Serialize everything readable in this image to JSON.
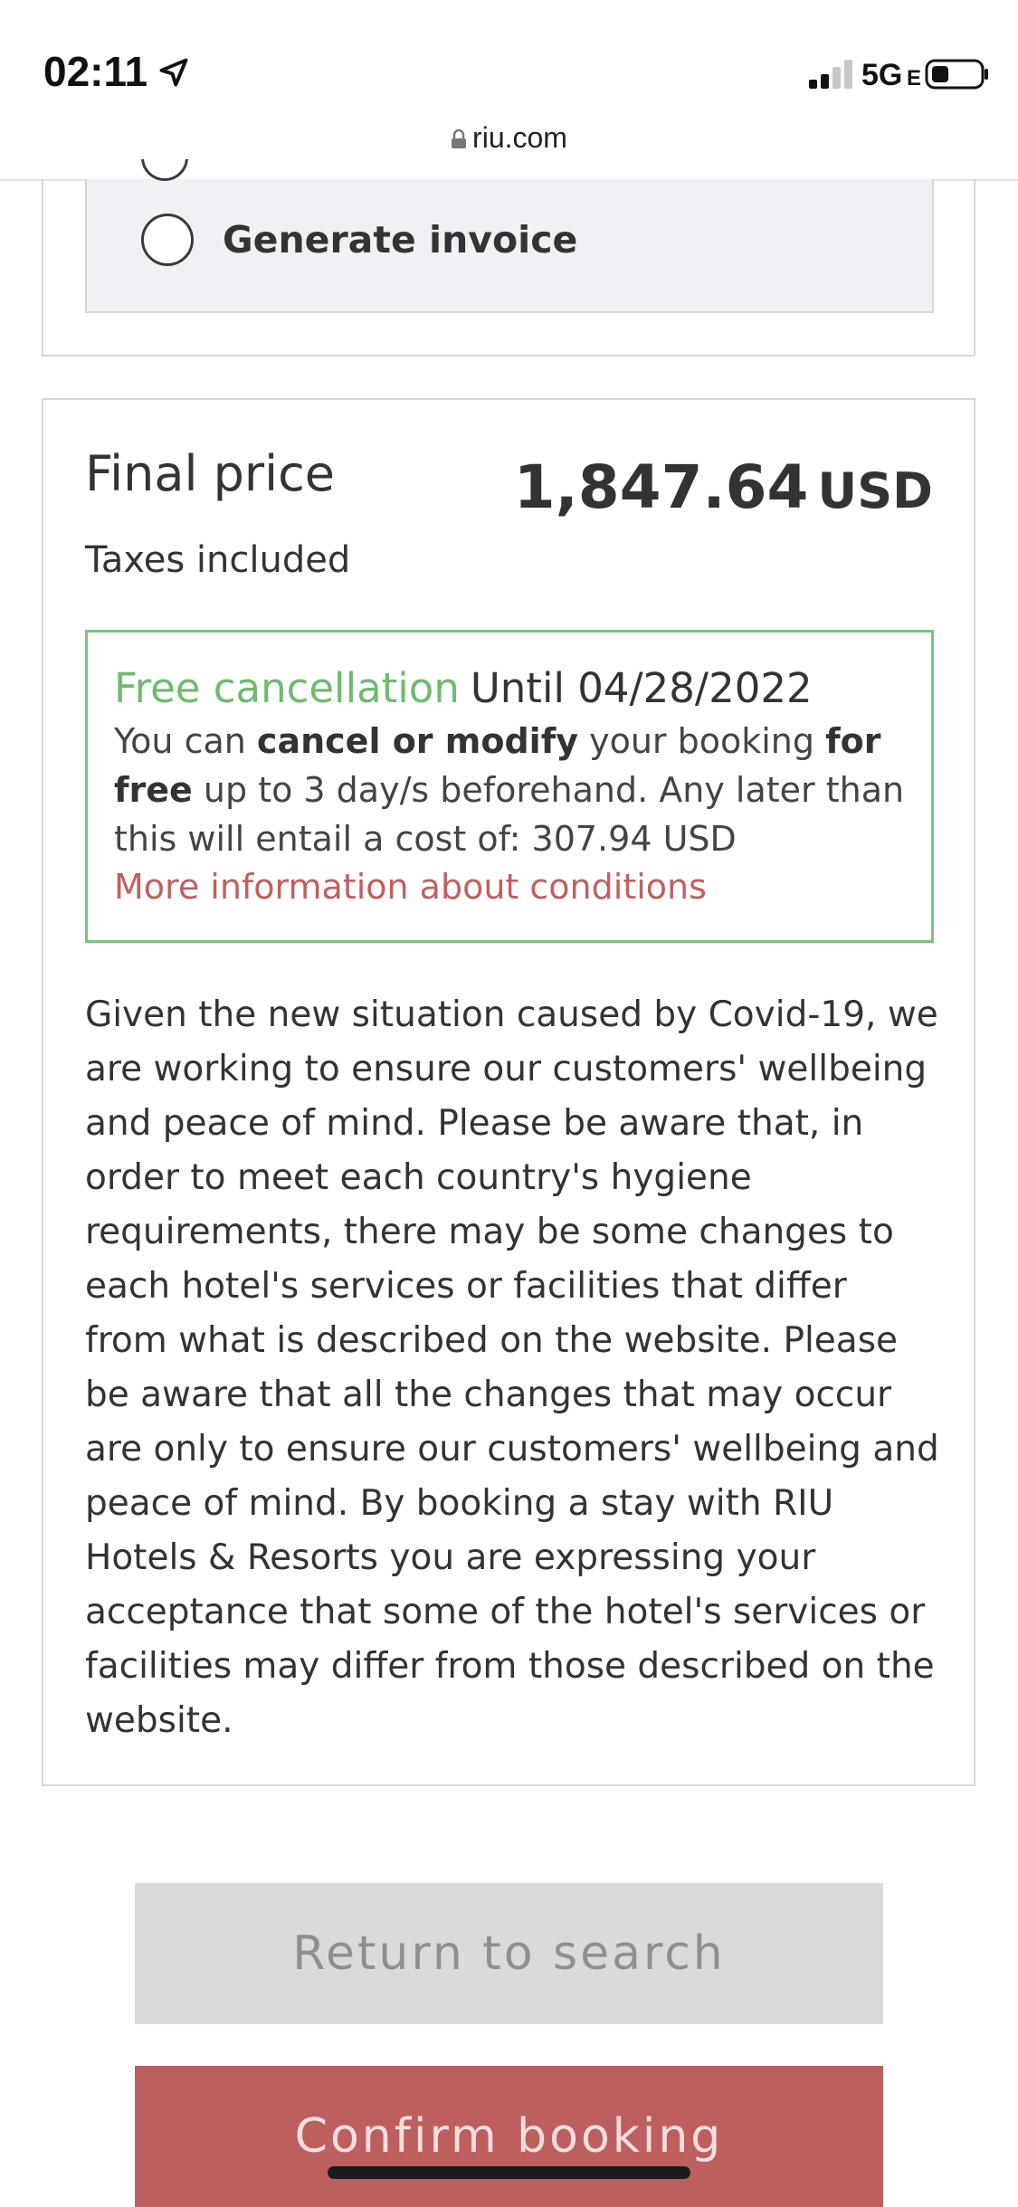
{
  "status_bar": {
    "time": "02:11",
    "network": "5G",
    "network_suffix": "E"
  },
  "browser": {
    "url": "riu.com"
  },
  "invoice": {
    "option_label": "Generate invoice"
  },
  "price": {
    "label": "Final price",
    "amount": "1,847.64",
    "currency": "USD",
    "taxes_note": "Taxes included"
  },
  "cancellation": {
    "title": "Free cancellation",
    "until": "Until 04/28/2022",
    "text_1": "You can ",
    "text_bold_1": "cancel or modify",
    "text_2": " your booking ",
    "text_bold_2": "for free",
    "text_3": " up to 3 day/s beforehand. Any later than this will entail a cost of: 307.94 USD",
    "link": "More information about conditions"
  },
  "notice": "Given the new situation caused by Covid-19, we are working to ensure our customers' wellbeing and peace of mind. Please be aware that, in order to meet each country's hygiene requirements, there may be some changes to each hotel's services or facilities that differ from what is described on the website. Please be aware that all the changes that may occur are only to ensure our customers' wellbeing and peace of mind. By booking a stay with RIU Hotels & Resorts you are expressing your acceptance that some of the hotel's services or facilities may differ from those described on the website.",
  "buttons": {
    "return": "Return to search",
    "confirm": "Confirm booking"
  },
  "colors": {
    "accent_green": "#6dbb6d",
    "accent_red": "#bd5f5f",
    "link_red": "#c0605f"
  },
  "icons": [
    "location-arrow-icon",
    "signal-icon",
    "battery-icon",
    "lock-icon",
    "radio-icon"
  ]
}
